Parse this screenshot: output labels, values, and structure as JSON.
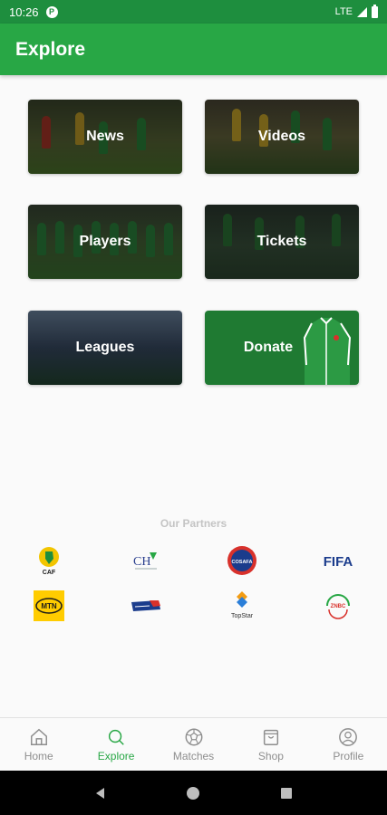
{
  "status_bar": {
    "time": "10:26",
    "network": "LTE"
  },
  "header": {
    "title": "Explore"
  },
  "tiles": [
    {
      "label": "News"
    },
    {
      "label": "Videos"
    },
    {
      "label": "Players"
    },
    {
      "label": "Tickets"
    },
    {
      "label": "Leagues"
    },
    {
      "label": "Donate"
    }
  ],
  "partners": {
    "title": "Our Partners",
    "logos": [
      {
        "name": "caf-logo",
        "text": "CAF"
      },
      {
        "name": "ch-logo",
        "text": "CH"
      },
      {
        "name": "cosafa-logo",
        "text": "COSAFA"
      },
      {
        "name": "fifa-logo",
        "text": "FIFA"
      },
      {
        "name": "mtn-logo",
        "text": "MTN"
      },
      {
        "name": "partner-blue-logo",
        "text": ""
      },
      {
        "name": "topstar-logo",
        "text": "TopStar"
      },
      {
        "name": "znbc-logo",
        "text": "ZNBC"
      }
    ]
  },
  "bottom_nav": {
    "items": [
      {
        "label": "Home",
        "icon": "home-icon"
      },
      {
        "label": "Explore",
        "icon": "search-icon",
        "active": true
      },
      {
        "label": "Matches",
        "icon": "soccer-ball-icon"
      },
      {
        "label": "Shop",
        "icon": "shopping-bag-icon"
      },
      {
        "label": "Profile",
        "icon": "person-icon"
      }
    ]
  },
  "colors": {
    "primary": "#28a745",
    "status_bar": "#1e8e3e",
    "inactive": "#8e8e8e"
  }
}
